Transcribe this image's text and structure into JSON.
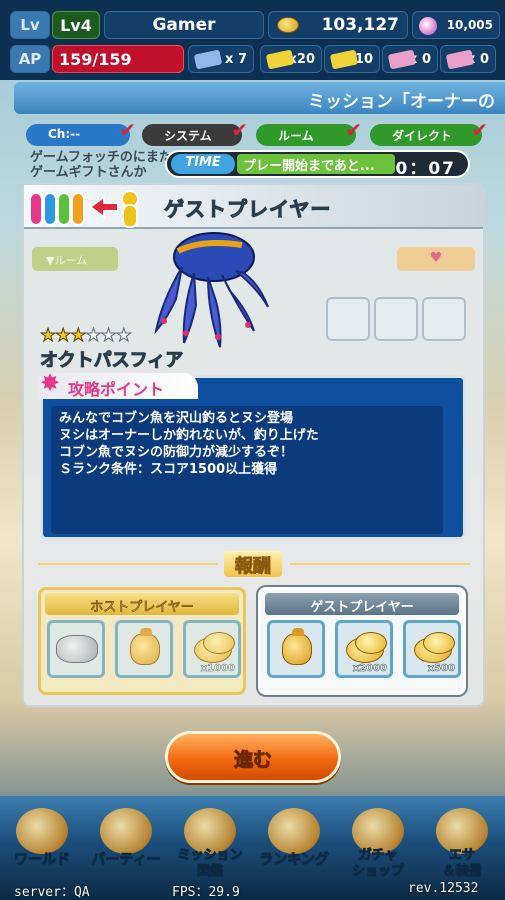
{
  "status": {
    "lv_label": "Lv",
    "lv_value": "Lv4",
    "player_name": "Gamer",
    "coins": "103,127",
    "gems": "10,005",
    "ap_label": "AP",
    "ap_value": "159/159",
    "tickets": [
      {
        "count": "x 7",
        "color": "#8fb8e8"
      },
      {
        "count": "x20",
        "color": "#f2d23a"
      },
      {
        "count": "x10",
        "color": "#f2d23a"
      },
      {
        "count": "x 0",
        "color": "#e8a0c8"
      },
      {
        "count": "x 0",
        "color": "#e8a0c8"
      }
    ]
  },
  "banner": {
    "text": "ミッション「オーナーの"
  },
  "chat_filters": [
    {
      "label": "Ch:--",
      "color": "#2a78c8"
    },
    {
      "label": "システム",
      "color": "#3a3a3a"
    },
    {
      "label": "ルーム",
      "color": "#2f9a2a"
    },
    {
      "label": "ダイレクト",
      "color": "#2f9a2a"
    }
  ],
  "background_text": [
    "ゲームフォッチのにまた",
    "ゲームギフトさんか"
  ],
  "timer": {
    "tag": "TIME",
    "message": "プレー開始まであと...",
    "value": "0：07"
  },
  "modal": {
    "title": "ゲストプレイヤー",
    "room_label": "▼ルーム",
    "heart": "♥",
    "stars_on": "★★★",
    "stars_off": "★★★",
    "boss_name": "オクトパスフィア",
    "strategy_label": "攻略ポイント",
    "strategy_lines": [
      "みんなでコブン魚を沢山釣るとヌシ登場",
      "ヌシはオーナーしか釣れないが、釣り上げた",
      "コブン魚でヌシの防御力が減少するぞ！",
      "Ｓランク条件：スコア1500以上獲得"
    ],
    "reward_title": "報酬",
    "host": {
      "label": "ホストプレイヤー",
      "items": [
        {
          "icon": "fish-icon",
          "qty": ""
        },
        {
          "icon": "money-bag-icon",
          "qty": ""
        },
        {
          "icon": "coin-icon",
          "qty": "x1000"
        }
      ]
    },
    "guest": {
      "label": "ゲストプレイヤー",
      "items": [
        {
          "icon": "money-bag-icon",
          "qty": ""
        },
        {
          "icon": "coin-icon",
          "qty": "x2000"
        },
        {
          "icon": "coin-icon",
          "qty": "x500"
        }
      ]
    }
  },
  "proceed_label": "進む",
  "nav": [
    {
      "label": "ワールド",
      "icon": "ship-wheel-icon"
    },
    {
      "label": "パーティー",
      "icon": "handshake-icon"
    },
    {
      "label": "ミッション\n図鑑",
      "icon": "book-icon"
    },
    {
      "label": "ランキング",
      "icon": "crown-icon"
    },
    {
      "label": "ガチャ\nショップ",
      "icon": "capsule-icon"
    },
    {
      "label": "エサ\n＆装備",
      "icon": "bait-icon"
    }
  ],
  "debug": {
    "server": "server：QA",
    "fps": "FPS：29.9",
    "rev": "rev.12532"
  }
}
